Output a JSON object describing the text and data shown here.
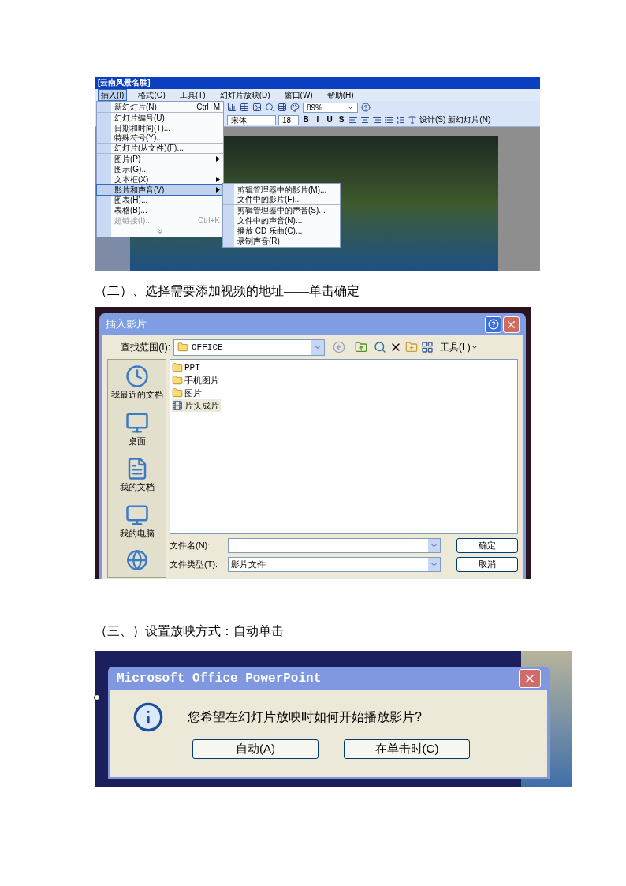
{
  "screenshot_1": {
    "title": "[云南风景名胜]",
    "menubar": [
      {
        "label": "插入(I)",
        "selected": true
      },
      {
        "label": "格式(O)",
        "selected": false
      },
      {
        "label": "工具(T)",
        "selected": false
      },
      {
        "label": "幻灯片放映(D)",
        "selected": false
      },
      {
        "label": "窗口(W)",
        "selected": false
      },
      {
        "label": "帮助(H)",
        "selected": false
      }
    ],
    "toolbar_1": {
      "zoom": "89%"
    },
    "toolbar_2": {
      "font": "宋体",
      "size": "18",
      "format_buttons": [
        "B",
        "I",
        "U",
        "S"
      ],
      "design": "设计(S)",
      "new_slide": "新幻灯片(N)"
    },
    "menu": [
      {
        "kind": "item",
        "label": "新幻灯片(N)",
        "shortcut": "Ctrl+M",
        "selected": false,
        "disabled": false,
        "divider": true
      },
      {
        "kind": "item",
        "label": "幻灯片编号(U)",
        "selected": false,
        "disabled": false,
        "divider": false
      },
      {
        "kind": "item",
        "label": "日期和时间(T)...",
        "selected": false,
        "disabled": false,
        "divider": false
      },
      {
        "kind": "item",
        "label": "特殊符号(Y)...",
        "selected": false,
        "disabled": false,
        "divider": true
      },
      {
        "kind": "item",
        "label": "幻灯片(从文件)(F)...",
        "selected": false,
        "disabled": false,
        "divider": true
      },
      {
        "kind": "submenu",
        "label": "图片(P)",
        "selected": false,
        "disabled": false,
        "divider": false
      },
      {
        "kind": "item",
        "label": "图示(G)...",
        "selected": false,
        "disabled": false,
        "divider": false
      },
      {
        "kind": "submenu",
        "label": "文本框(X)",
        "selected": false,
        "disabled": false,
        "divider": false
      },
      {
        "kind": "submenu",
        "label": "影片和声音(V)",
        "selected": true,
        "disabled": false,
        "divider": false
      },
      {
        "kind": "item",
        "label": "图表(H)...",
        "selected": false,
        "disabled": false,
        "divider": false
      },
      {
        "kind": "item",
        "label": "表格(B)...",
        "selected": false,
        "disabled": false,
        "divider": false
      },
      {
        "kind": "item",
        "label": "超链接(I)...",
        "shortcut": "Ctrl+K",
        "selected": false,
        "disabled": true,
        "divider": false
      },
      {
        "kind": "more",
        "selected": false,
        "disabled": false,
        "divider": false
      }
    ],
    "submenu": [
      {
        "label": "剪辑管理器中的影片(M)...",
        "divider": false
      },
      {
        "label": "文件中的影片(F)...",
        "divider": true
      },
      {
        "label": "剪辑管理器中的声音(S)...",
        "divider": false
      },
      {
        "label": "文件中的声音(N)...",
        "divider": false
      },
      {
        "label": "播放 CD 乐曲(C)...",
        "divider": false
      },
      {
        "label": "录制声音(R)",
        "divider": false
      }
    ]
  },
  "caption_2": "（二）、选择需要添加视频的地址——单击确定",
  "dialog_2": {
    "title": "插入影片",
    "look_in_label": "查找范围(I):",
    "look_in": "OFFICE",
    "tools": "工具(L)",
    "places": [
      {
        "kind": "recent",
        "label": "我最近的文档"
      },
      {
        "kind": "desktop",
        "label": "桌面"
      },
      {
        "kind": "documents",
        "label": "我的文档"
      },
      {
        "kind": "computer",
        "label": "我的电脑"
      }
    ],
    "files": [
      {
        "kind": "folder",
        "name": "PPT",
        "selected": false
      },
      {
        "kind": "folder",
        "name": "手机图片",
        "selected": false
      },
      {
        "kind": "folder",
        "name": "图片",
        "selected": false
      },
      {
        "kind": "video",
        "name": "片头成片",
        "selected": true
      }
    ],
    "file_name_label": "文件名(N):",
    "file_type_label": "文件类型(T):",
    "file_type": "影片文件",
    "ok": "确定",
    "cancel": "取消"
  },
  "caption_3": "（三、）设置放映方式：自动单击",
  "dialog_3": {
    "title": "Microsoft Office PowerPoint",
    "message": "您希望在幻灯片放映时如何开始播放影片?",
    "buttons": [
      "自动(A)",
      "在单击时(C)"
    ]
  }
}
